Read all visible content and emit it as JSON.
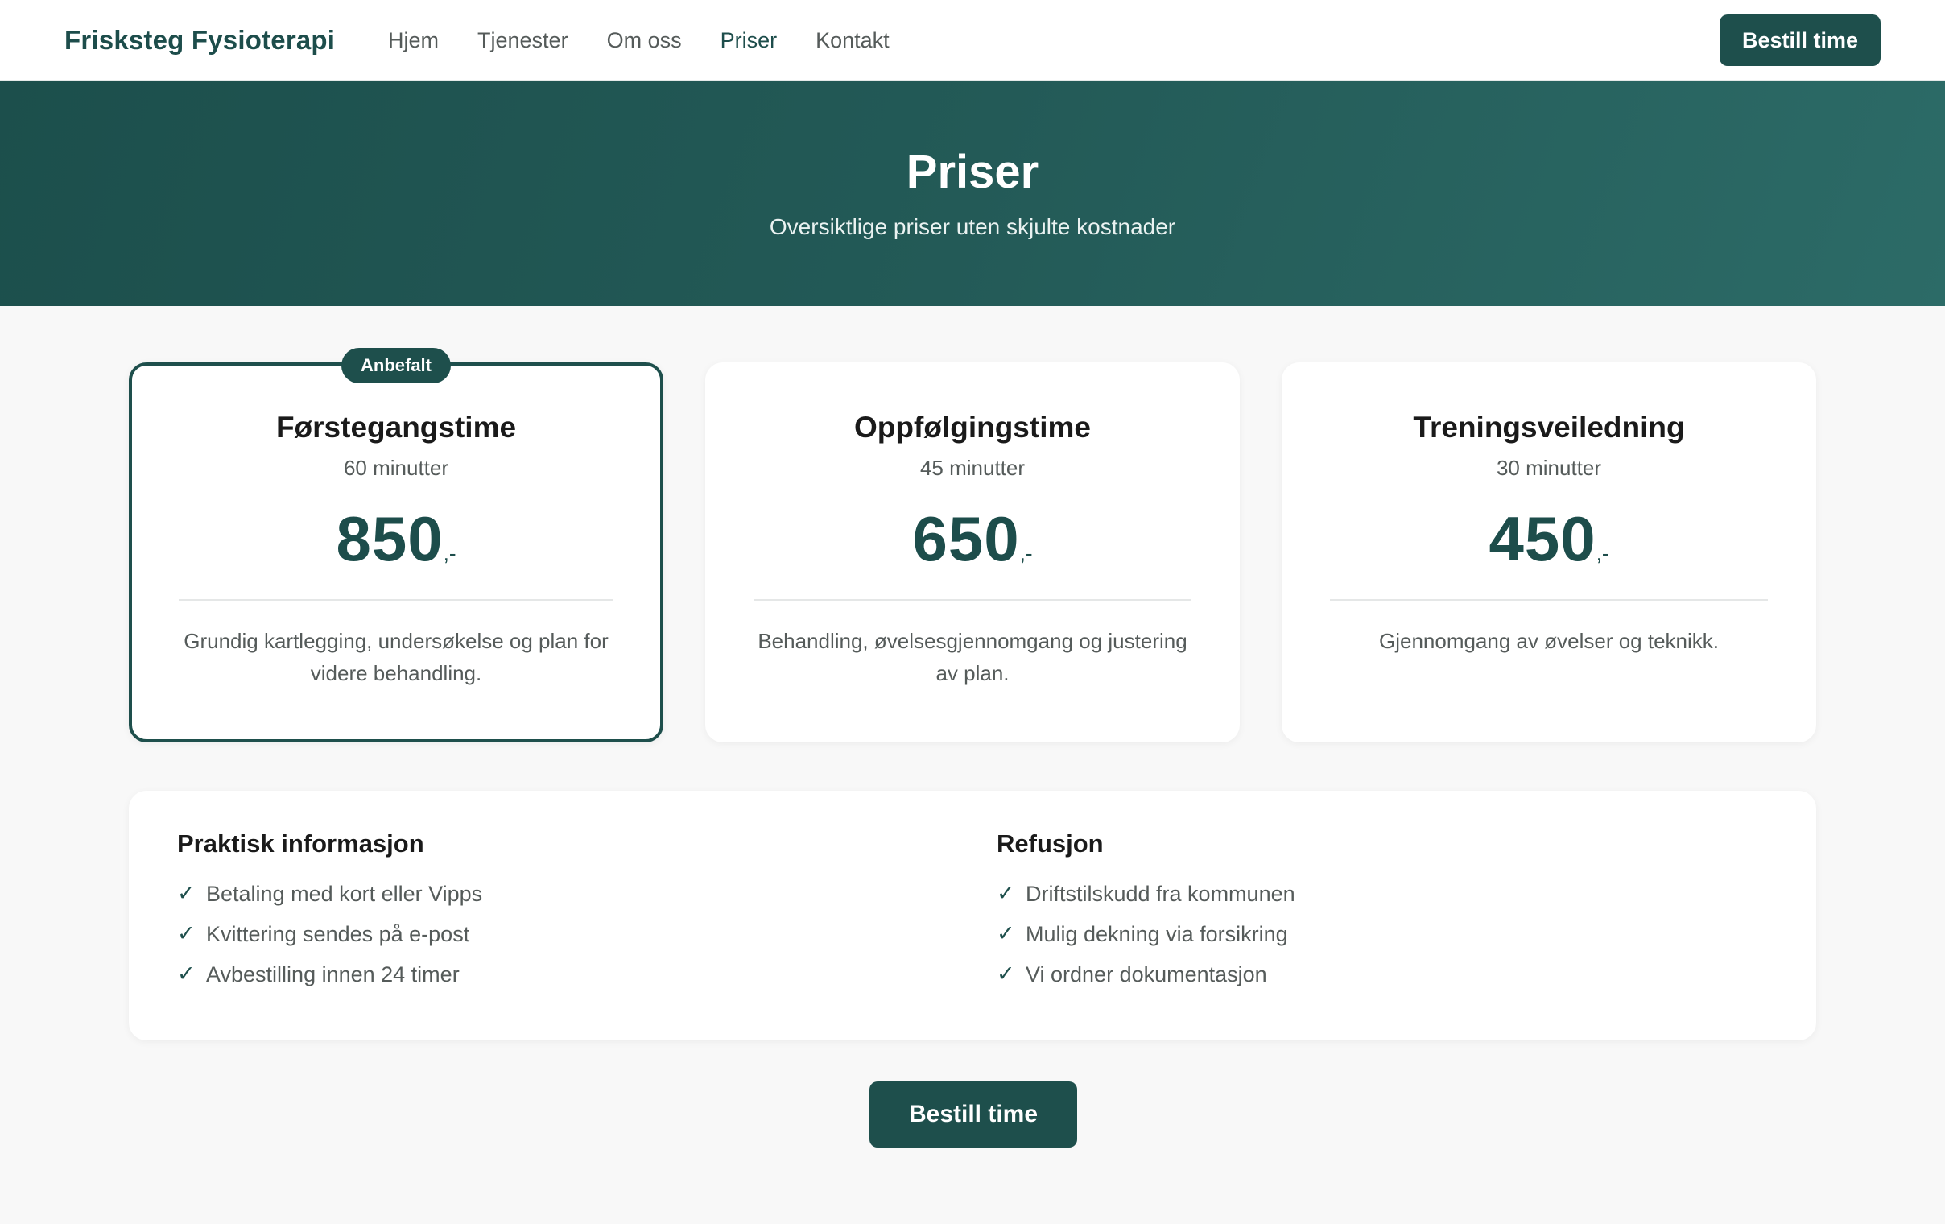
{
  "header": {
    "brand": "Frisksteg Fysioterapi",
    "nav": [
      {
        "label": "Hjem",
        "active": false
      },
      {
        "label": "Tjenester",
        "active": false
      },
      {
        "label": "Om oss",
        "active": false
      },
      {
        "label": "Priser",
        "active": true
      },
      {
        "label": "Kontakt",
        "active": false
      }
    ],
    "cta_label": "Bestill time"
  },
  "hero": {
    "title": "Priser",
    "subtitle": "Oversiktlige priser uten skjulte kostnader"
  },
  "pricing": [
    {
      "badge": "Anbefalt",
      "title": "Førstegangstime",
      "duration": "60 minutter",
      "price": "850",
      "price_suffix": ",-",
      "description": "Grundig kartlegging, undersøkelse og plan for videre behandling."
    },
    {
      "title": "Oppfølgingstime",
      "duration": "45 minutter",
      "price": "650",
      "price_suffix": ",-",
      "description": "Behandling, øvelsesgjennomgang og justering av plan."
    },
    {
      "title": "Treningsveiledning",
      "duration": "30 minutter",
      "price": "450",
      "price_suffix": ",-",
      "description": "Gjennomgang av øvelser og teknikk."
    }
  ],
  "info": {
    "practical": {
      "heading": "Praktisk informasjon",
      "items": [
        "Betaling med kort eller Vipps",
        "Kvittering sendes på e-post",
        "Avbestilling innen 24 timer"
      ]
    },
    "refund": {
      "heading": "Refusjon",
      "items": [
        "Driftstilskudd fra kommunen",
        "Mulig dekning via forsikring",
        "Vi ordner dokumentasjon"
      ]
    },
    "check_glyph": "✓"
  },
  "bottom_cta_label": "Bestill time",
  "colors": {
    "accent": "#1e4f4c",
    "hero_start": "#1c4f4c",
    "hero_end": "#2c6b67",
    "text_muted": "#555b5a",
    "background": "#f8f8f8"
  }
}
